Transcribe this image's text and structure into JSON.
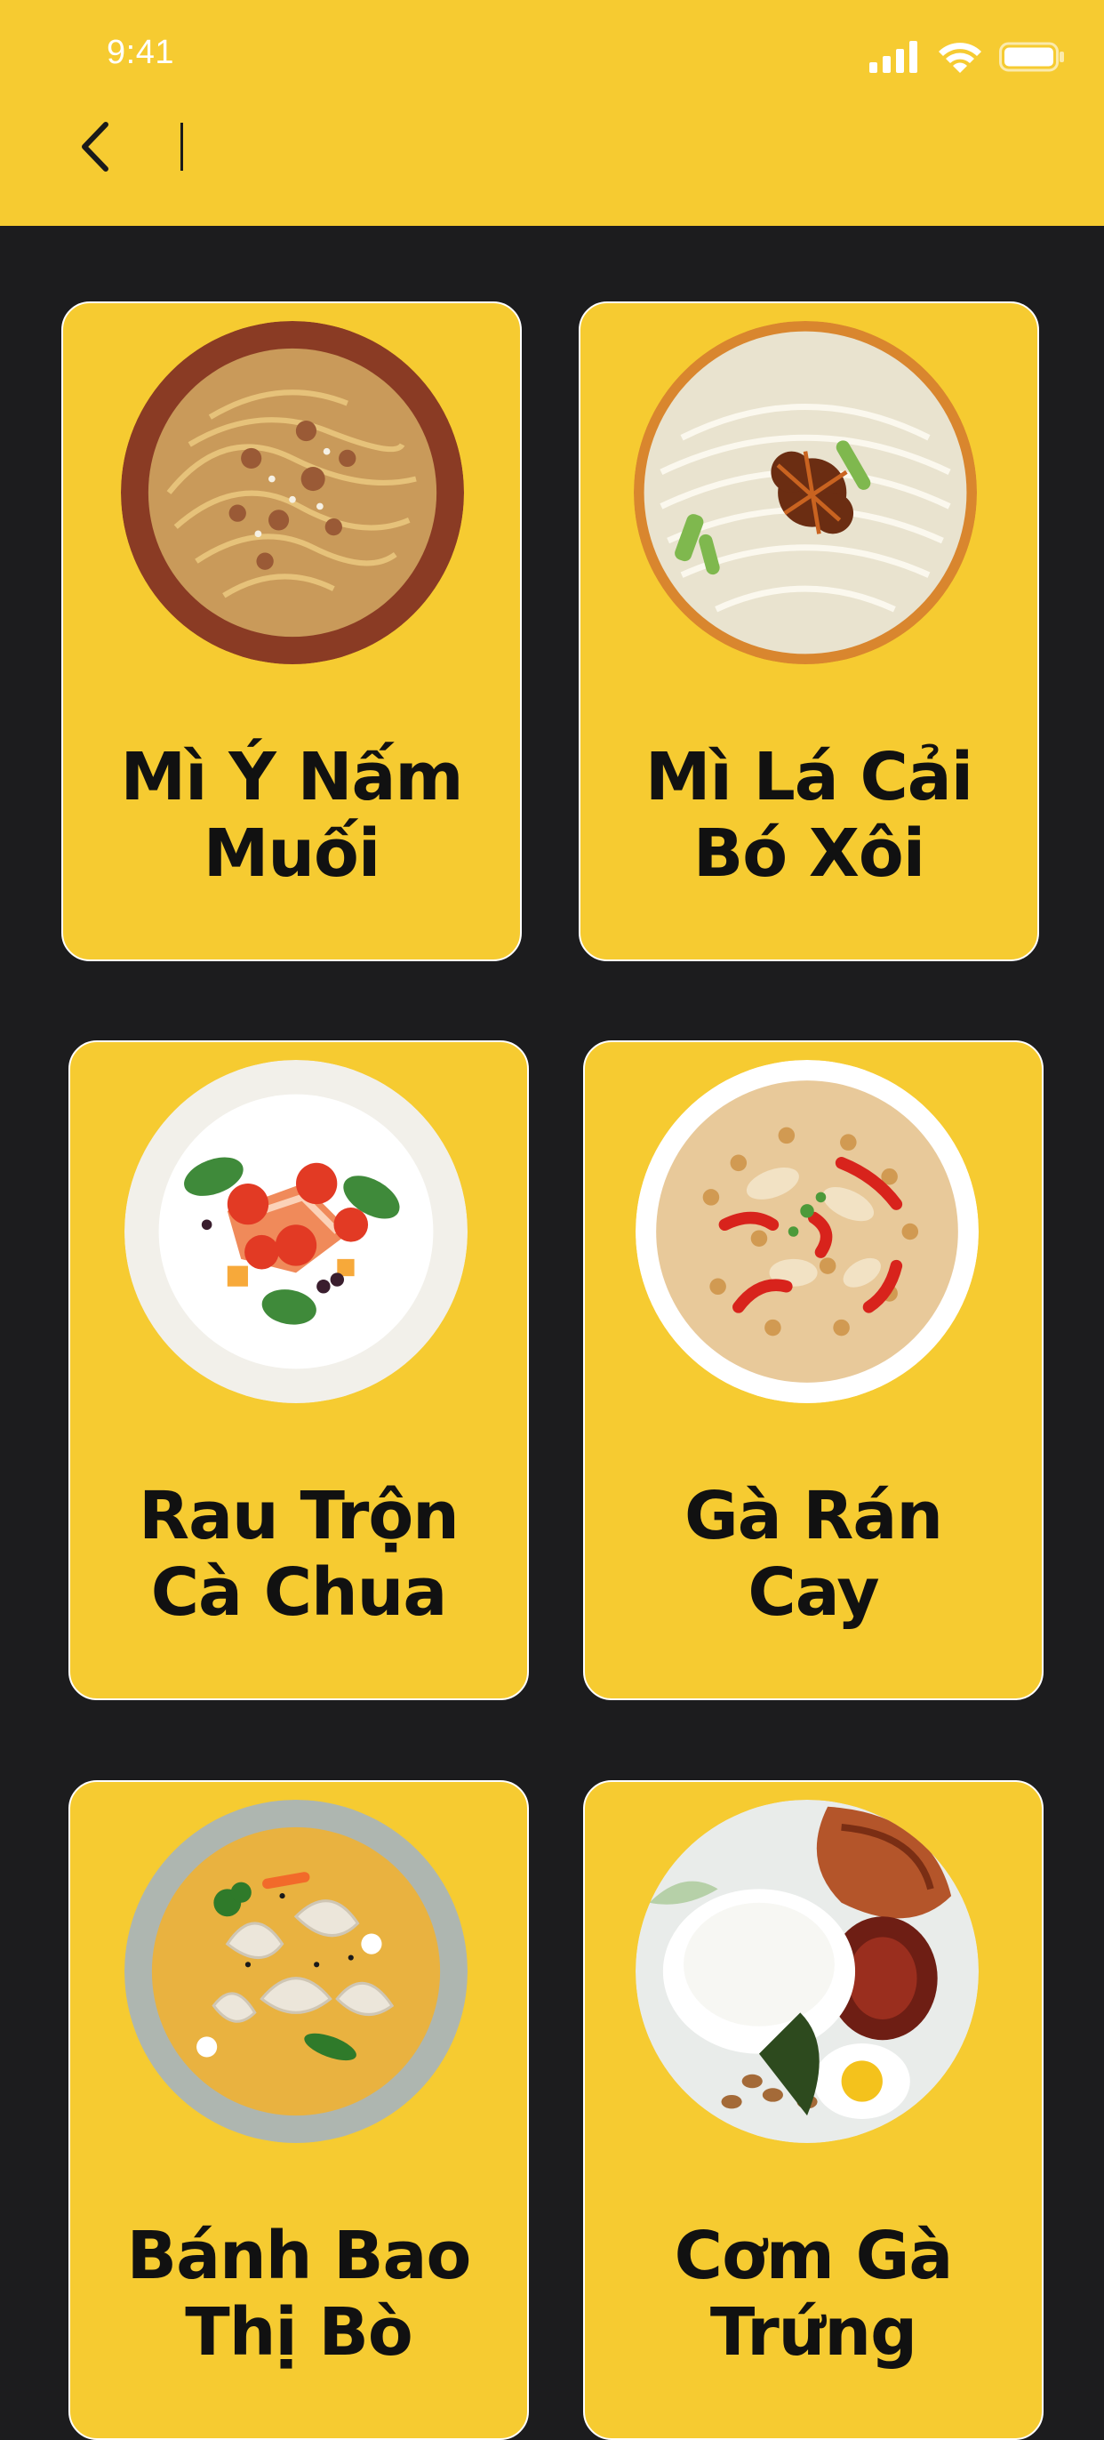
{
  "status_bar": {
    "time": "9:41"
  },
  "header": {
    "back_icon": "chevron-left-icon"
  },
  "colors": {
    "header": "#f6cb31",
    "background": "#1c1c1e",
    "card": "#f6cb31",
    "text": "#111111"
  },
  "dishes": [
    {
      "line1": "Mì Ý Nấm",
      "line2": "Muối"
    },
    {
      "line1": "Mì Lá Cải",
      "line2": "Bó Xôi"
    },
    {
      "line1": "Rau Trộn",
      "line2": "Cà Chua"
    },
    {
      "line1": "Gà Rán",
      "line2": "Cay"
    },
    {
      "line1": "Bánh Bao",
      "line2": "Thị Bò"
    },
    {
      "line1": "Cơm Gà",
      "line2": "Trứng"
    }
  ]
}
